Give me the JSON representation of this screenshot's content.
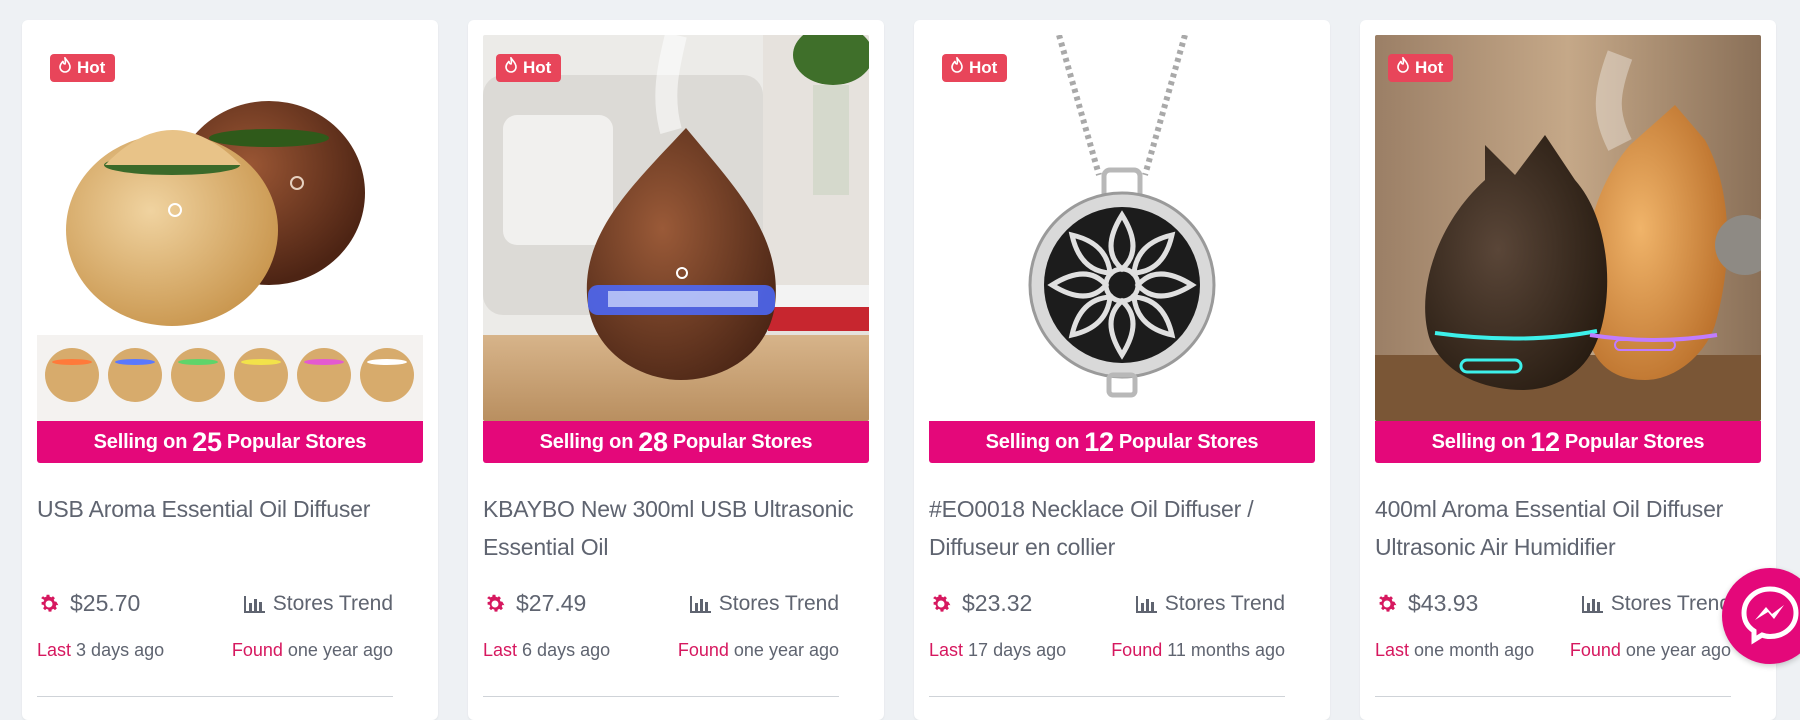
{
  "colors": {
    "accent": "#e4087a",
    "hot": "#e8455a",
    "label": "#d6185f",
    "text": "#5f6470",
    "background": "#eef1f4"
  },
  "labels": {
    "hot": "Hot",
    "selling_prefix": "Selling on",
    "selling_suffix": "Popular Stores",
    "stores_trend": "Stores Trend",
    "last": "Last",
    "found": "Found"
  },
  "icons": {
    "hot": "flame-icon",
    "price": "gear-icon",
    "trend": "bar-chart-icon",
    "chat": "messenger-icon"
  },
  "products": [
    {
      "store_count": "25",
      "title": "USB Aroma Essential Oil Diffuser",
      "price": "$25.70",
      "last": "3 days ago",
      "found": "one year ago"
    },
    {
      "store_count": "28",
      "title": "KBAYBO New 300ml USB Ultrasonic Essential Oil",
      "price": "$27.49",
      "last": "6 days ago",
      "found": "one year ago"
    },
    {
      "store_count": "12",
      "title": "#EO0018 Necklace Oil Diffuser / Diffuseur en collier",
      "price": "$23.32",
      "last": "17 days ago",
      "found": "11 months ago"
    },
    {
      "store_count": "12",
      "title": "400ml Aroma Essential Oil Diffuser Ultrasonic Air Humidifier",
      "price": "$43.93",
      "last": "one month ago",
      "found": "one year ago"
    }
  ]
}
